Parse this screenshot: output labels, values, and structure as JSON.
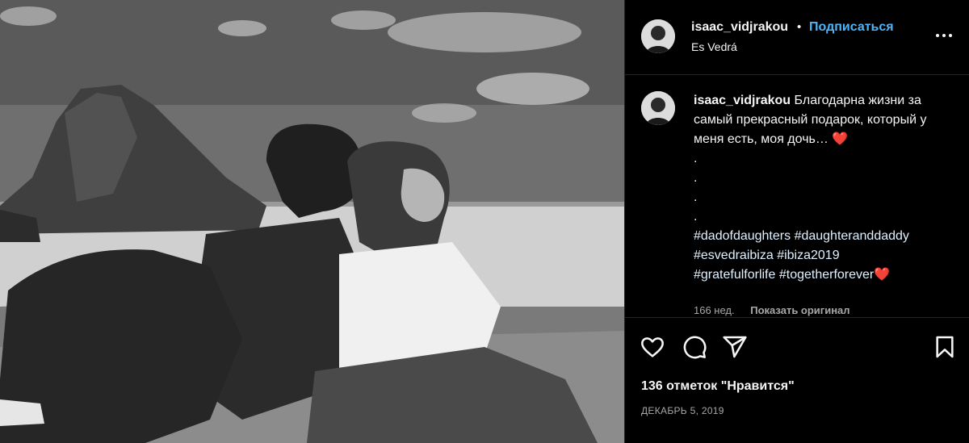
{
  "photo": {
    "alt_icon": "post-photo"
  },
  "header": {
    "username": "isaac_vidjrakou",
    "separator": "•",
    "follow_label": "Подписаться",
    "location": "Es Vedrá",
    "more_icon": "more-options-icon"
  },
  "caption": {
    "username": "isaac_vidjrakou",
    "text": "Благодарна жизни за самый прекрасный подарок, который у меня есть, моя дочь…",
    "heart": "❤️",
    "dots": [
      ".",
      ".",
      ".",
      "."
    ],
    "hashtags_line1": [
      "#dadofdaughters",
      "#daughteranddaddy"
    ],
    "hashtags_line2": [
      "#esvedraibiza",
      "#ibiza2019"
    ],
    "hashtags_line3": [
      "#gratefulforlife",
      "#togetherforever"
    ],
    "heart_end": "❤️",
    "age": "166 нед.",
    "translate_label": "Показать оригинал"
  },
  "actions": {
    "like_icon": "heart-icon",
    "comment_icon": "comment-icon",
    "share_icon": "share-icon",
    "save_icon": "bookmark-icon"
  },
  "likes": "136 отметок \"Нравится\"",
  "date": "ДЕКАБРЬ 5, 2019",
  "colors": {
    "accent": "#4db5f9",
    "background": "#000000",
    "text": "#f5f5f5",
    "muted": "#a8a8a8"
  }
}
